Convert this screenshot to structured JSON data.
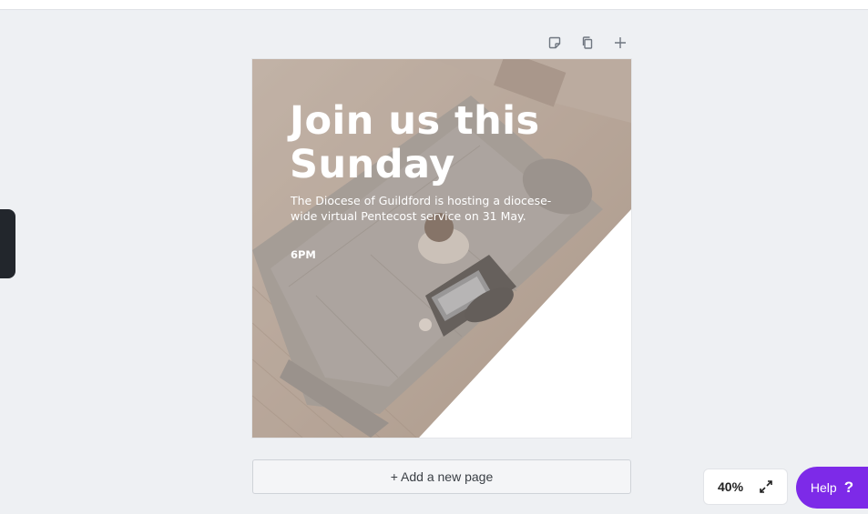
{
  "design": {
    "headline_line1": "Join us this",
    "headline_line2": "Sunday",
    "subtext": "The Diocese of Guildford is hosting a diocese-wide virtual Pentecost service on 31 May.",
    "time": "6PM"
  },
  "page_tools": {
    "icons": [
      "note-icon",
      "duplicate-icon",
      "add-icon"
    ]
  },
  "footer": {
    "add_page_label": "+ Add a new page",
    "zoom_value": "40%",
    "help_label": "Help",
    "help_glyph": "?"
  },
  "colors": {
    "canvas_bg": "#eef0f3",
    "help_purple": "#7d2ae8",
    "overlay": "#b5a69a"
  }
}
